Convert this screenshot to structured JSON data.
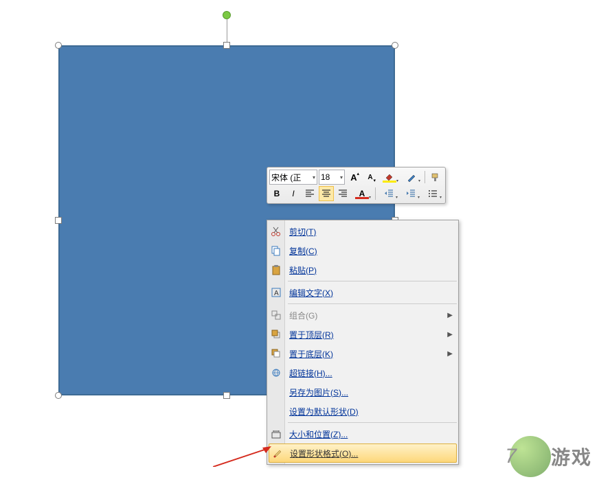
{
  "shape": {
    "selected": true
  },
  "toolbar": {
    "font": "宋体 (正",
    "font_size": "18",
    "bold": "B",
    "italic": "I"
  },
  "menu": [
    {
      "icon": "cut",
      "label": "剪切(T)",
      "type": "item"
    },
    {
      "icon": "copy",
      "label": "复制(C)",
      "type": "item"
    },
    {
      "icon": "paste",
      "label": "粘贴(P)",
      "type": "item"
    },
    {
      "type": "sep"
    },
    {
      "icon": "edit-text",
      "label": "编辑文字(X)",
      "type": "item"
    },
    {
      "type": "sep"
    },
    {
      "icon": "group",
      "label": "组合(G)",
      "type": "item",
      "submenu": true,
      "disabled": true
    },
    {
      "icon": "bring-front",
      "label": "置于顶层(R)",
      "type": "item",
      "submenu": true
    },
    {
      "icon": "send-back",
      "label": "置于底层(K)",
      "type": "item",
      "submenu": true
    },
    {
      "icon": "hyperlink",
      "label": "超链接(H)...",
      "type": "item"
    },
    {
      "icon": "",
      "label": "另存为图片(S)...",
      "type": "item"
    },
    {
      "icon": "",
      "label": "设置为默认形状(D)",
      "type": "item"
    },
    {
      "type": "sep"
    },
    {
      "icon": "size",
      "label": "大小和位置(Z)...",
      "type": "item"
    },
    {
      "icon": "format",
      "label": "设置形状格式(O)...",
      "type": "item",
      "highlighted": true
    }
  ],
  "watermark": {
    "num": "7",
    "text": "游戏"
  }
}
